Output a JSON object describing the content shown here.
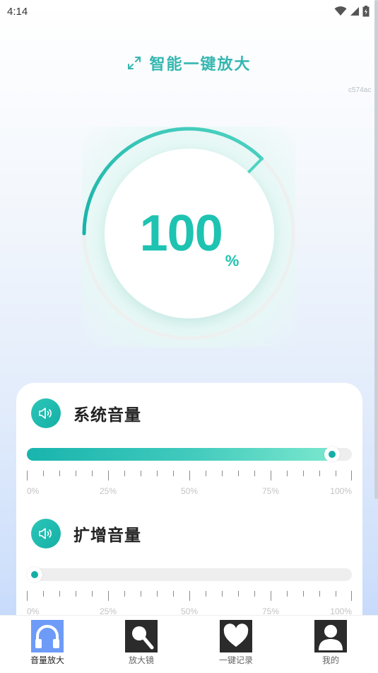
{
  "status_bar": {
    "time": "4:14"
  },
  "header": {
    "title": "智能一键放大",
    "expand_icon": "expand-arrows-icon"
  },
  "corner_code": "c574ac",
  "gauge": {
    "value": "100",
    "unit": "%",
    "progress": 0.64
  },
  "sections": [
    {
      "title": "系统音量",
      "icon": "speaker-icon",
      "level_percent": 94,
      "ticks": [
        "0%",
        "25%",
        "50%",
        "75%",
        "100%"
      ]
    },
    {
      "title": "扩增音量",
      "icon": "speaker-icon",
      "level_percent": 0,
      "ticks": [
        "0%",
        "25%",
        "50%",
        "75%",
        "100%"
      ]
    }
  ],
  "tabs": [
    {
      "label": "音量放大",
      "icon": "headphones-icon",
      "active": true
    },
    {
      "label": "放大镜",
      "icon": "magnifier-icon",
      "active": false
    },
    {
      "label": "一键记录",
      "icon": "heart-icon",
      "active": false
    },
    {
      "label": "我的",
      "icon": "user-icon",
      "active": false
    }
  ],
  "colors": {
    "accent": "#1ec3b1",
    "accent_dark": "#14aea6",
    "title": "#35b7b0",
    "tab_active": "#6d9bf7",
    "tab_icon": "#2b2b2b"
  }
}
